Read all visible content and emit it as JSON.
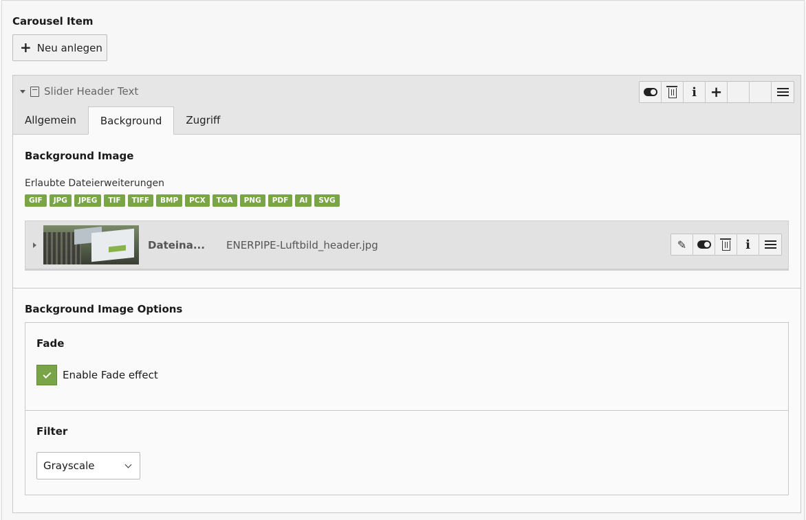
{
  "section": {
    "title": "Carousel Item",
    "new_button_label": "Neu anlegen"
  },
  "panel": {
    "title": "Slider Header Text",
    "tabs": [
      {
        "label": "Allgemein",
        "active": false
      },
      {
        "label": "Background",
        "active": true
      },
      {
        "label": "Zugriff",
        "active": false
      }
    ],
    "header_icons": [
      "toggle-icon",
      "trash-icon",
      "info-icon",
      "plus-icon",
      "empty",
      "empty",
      "menu-icon"
    ]
  },
  "background": {
    "title": "Background Image",
    "allowed_label": "Erlaubte Dateierweiterungen",
    "extensions": [
      "GIF",
      "JPG",
      "JPEG",
      "TIF",
      "TIFF",
      "BMP",
      "PCX",
      "TGA",
      "PNG",
      "PDF",
      "AI",
      "SVG"
    ],
    "file": {
      "label": "Dateina...",
      "name": "ENERPIPE-Luftbild_header.jpg",
      "icons": [
        "pencil-icon",
        "toggle-icon",
        "trash-icon",
        "info-icon",
        "menu-icon"
      ]
    }
  },
  "options": {
    "title": "Background Image Options",
    "fade": {
      "title": "Fade",
      "checkbox_label": "Enable Fade effect",
      "checked": true
    },
    "filter": {
      "title": "Filter",
      "selected": "Grayscale"
    }
  },
  "colors": {
    "accent_green": "#79a548",
    "header_gray": "#e6e6e6"
  }
}
